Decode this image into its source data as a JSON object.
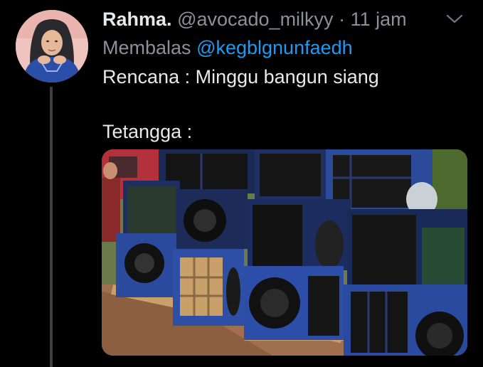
{
  "tweet": {
    "author_name": "Rahma.",
    "author_handle": "@avocado_milkyy",
    "separator": "·",
    "time": "11 jam",
    "reply_label": "Membalas",
    "reply_mention": "@kegblgnunfaedh",
    "text_line1": "Rencana : Minggu bangun siang",
    "text_line2": "Tetangga :"
  },
  "icons": {
    "more": "chevron-down-icon"
  },
  "colors": {
    "background": "#000000",
    "text": "#e7e9ea",
    "muted": "#8b9196",
    "link": "#1d9bf0",
    "thread_line": "#3a3f44"
  }
}
